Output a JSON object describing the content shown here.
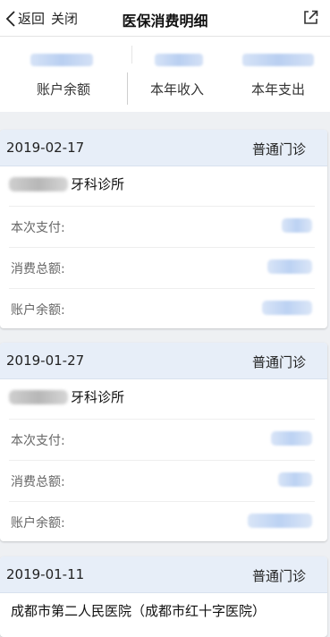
{
  "nav": {
    "back_label": "返回",
    "close_label": "关闭",
    "title": "医保消费明细"
  },
  "summary": {
    "balance_label": "账户余额",
    "income_label": "本年收入",
    "expense_label": "本年支出"
  },
  "records": [
    {
      "date": "2019-02-17",
      "type": "普通门诊",
      "clinic": "牙科诊所",
      "payment_label": "本次支付:",
      "total_label": "消费总额:",
      "balance_label": "账户余额:"
    },
    {
      "date": "2019-01-27",
      "type": "普通门诊",
      "clinic": "牙科诊所",
      "payment_label": "本次支付:",
      "total_label": "消费总额:",
      "balance_label": "账户余额:"
    },
    {
      "date": "2019-01-11",
      "type": "普通门诊",
      "clinic": "成都市第二人民医院（成都市红十字医院）"
    }
  ],
  "colors": {
    "card_header_bg": "#e7eef8",
    "page_bg": "#eef0f3",
    "redaction_blue": "#bcd2f3"
  }
}
